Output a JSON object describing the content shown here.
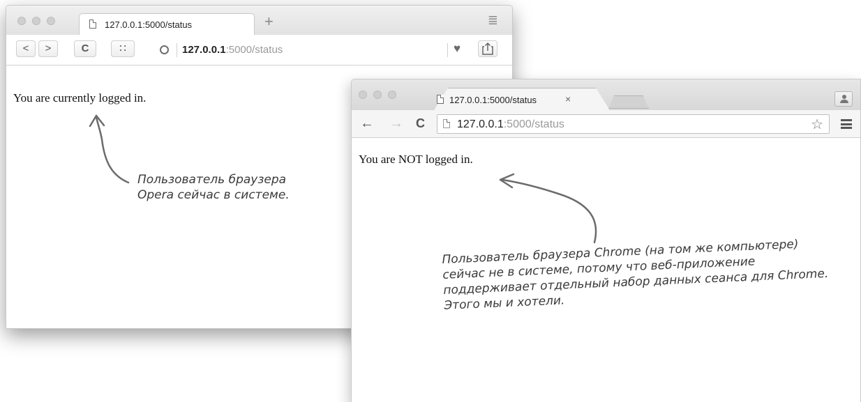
{
  "opera": {
    "tab_title": "127.0.0.1:5000/status",
    "new_tab_label": "+",
    "back_label": "<",
    "forward_label": ">",
    "reload_label": "C",
    "grid_label": "∷",
    "menu_icon": "≣",
    "address_host": "127.0.0.1",
    "address_path": ":5000/status",
    "heart_icon": "♥",
    "message": "You are currently logged in."
  },
  "chrome": {
    "tab_title": "127.0.0.1:5000/status",
    "tab_close": "×",
    "back_label": "←",
    "forward_label": "→",
    "reload_label": "C",
    "address_host": "127.0.0.1",
    "address_path": ":5000/status",
    "star_icon": "☆",
    "message": "You are NOT logged in."
  },
  "annotations": {
    "opera_note": "Пользователь браузера Opera сейчас в системе.",
    "chrome_note": "Пользователь браузера Chrome (на том же компьютере) сейчас не в системе, потому что веб-приложение поддерживает отдельный набор данных сеанса для Chrome. Этого мы и хотели."
  }
}
